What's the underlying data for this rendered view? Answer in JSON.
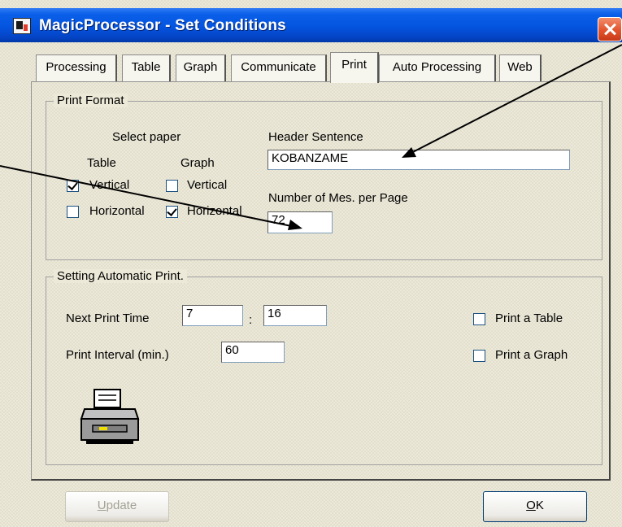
{
  "window": {
    "title": "MagicProcessor - Set Conditions"
  },
  "tabs": [
    {
      "label": "Processing"
    },
    {
      "label": "Table"
    },
    {
      "label": "Graph"
    },
    {
      "label": "Communicate"
    },
    {
      "label": "Print",
      "active": true
    },
    {
      "label": "Auto Processing"
    },
    {
      "label": "Web"
    }
  ],
  "print_format": {
    "title": "Print Format",
    "select_paper_label": "Select paper",
    "table_label": "Table",
    "graph_label": "Graph",
    "table_vertical_label": "Vertical",
    "table_vertical_checked": true,
    "table_horizontal_label": "Horizontal",
    "table_horizontal_checked": false,
    "graph_vertical_label": "Vertical",
    "graph_vertical_checked": false,
    "graph_horizontal_label": "Horizontal",
    "graph_horizontal_checked": true,
    "header_sentence_label": "Header Sentence",
    "header_sentence_value": "KOBANZAME",
    "mes_per_page_label": "Number of Mes. per Page",
    "mes_per_page_value": "72"
  },
  "auto_print": {
    "title": "Setting Automatic Print.",
    "next_print_time_label": "Next Print Time",
    "hour_value": "7",
    "separator": ":",
    "minute_value": "16",
    "interval_label": "Print Interval (min.)",
    "interval_value": "60",
    "print_table_label": "Print a Table",
    "print_table_checked": false,
    "print_graph_label": "Print a Graph",
    "print_graph_checked": false,
    "printer_icon": "printer-icon"
  },
  "buttons": {
    "update_prefix": "",
    "update_underlined": "U",
    "update_rest": "pdate",
    "ok_underlined": "O",
    "ok_rest": "K"
  },
  "colors": {
    "titlebar": "#0454df",
    "dialog_bg": "#ece9d8",
    "close_button": "#e2532d"
  }
}
